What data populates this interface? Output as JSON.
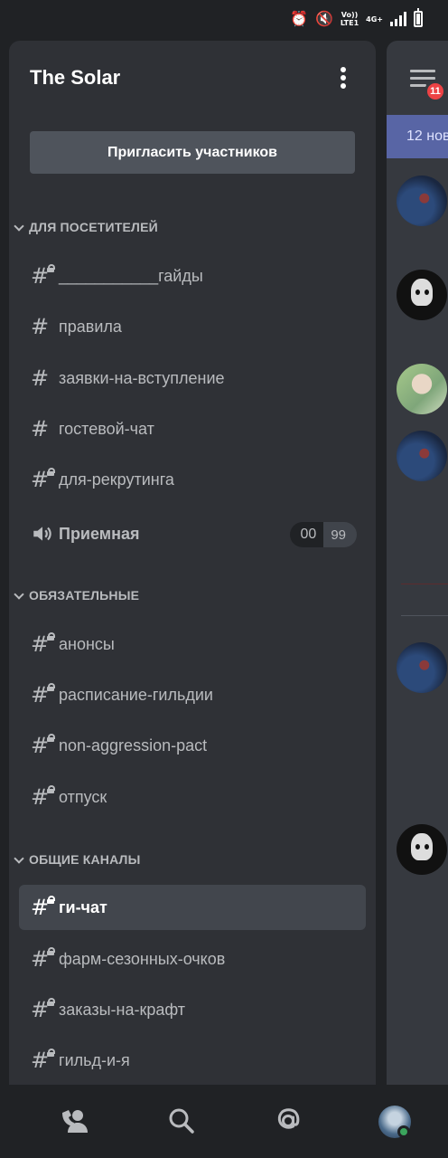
{
  "server": {
    "name": "The Solar",
    "invite_label": "Пригласить участников"
  },
  "categories": [
    {
      "label": "ДЛЯ ПОСЕТИТЕЛЕЙ"
    },
    {
      "label": "ОБЯЗАТЕЛЬНЫЕ"
    },
    {
      "label": "ОБЩИЕ КАНАЛЫ"
    }
  ],
  "channels": [
    {
      "name": "___________гайды",
      "locked": true
    },
    {
      "name": "правила",
      "locked": false
    },
    {
      "name": "заявки-на-вступление",
      "locked": false
    },
    {
      "name": "гостевой-чат",
      "locked": false
    },
    {
      "name": "для-рекрутинга",
      "locked": true
    },
    {
      "name": "анонсы",
      "locked": true
    },
    {
      "name": "расписание-гильдии",
      "locked": true
    },
    {
      "name": "non-aggression-pact",
      "locked": true
    },
    {
      "name": "отпуск",
      "locked": true
    },
    {
      "name": "ги-чат",
      "locked": true,
      "active": true
    },
    {
      "name": "фарм-сезонных-очков",
      "locked": true
    },
    {
      "name": "заказы-на-крафт",
      "locked": true
    },
    {
      "name": "гильд-и-я",
      "locked": true
    }
  ],
  "voice": {
    "name": "Приемная",
    "count_current": "00",
    "count_limit": "99"
  },
  "right": {
    "badge": "11",
    "date": "12 нов"
  },
  "status_bar": {
    "volte": "Vo))",
    "lte": "LTE1",
    "net": "4G+"
  },
  "colors": {
    "accent": "#5865a5",
    "badge": "#ed4245",
    "online": "#3ba55d"
  },
  "icons": [
    "alarm-icon",
    "mute-icon",
    "signal-icon",
    "battery-icon",
    "menu-icon",
    "friends-icon",
    "search-icon",
    "mention-icon",
    "speaker-icon",
    "hash-icon",
    "lock-icon"
  ]
}
